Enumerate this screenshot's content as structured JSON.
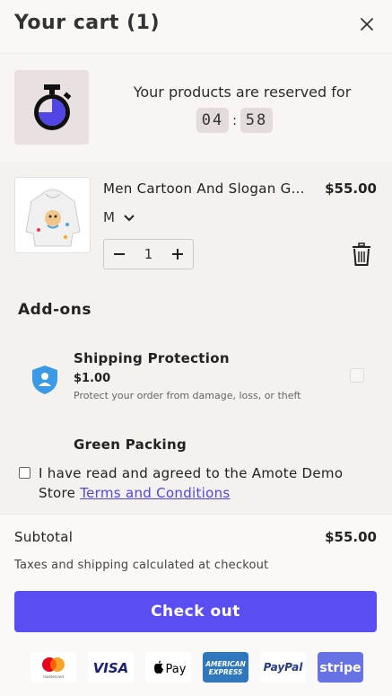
{
  "header": {
    "title": "Your cart (1)"
  },
  "timer": {
    "message": "Your products are reserved for",
    "minutes": "04",
    "separator": ":",
    "seconds": "58"
  },
  "cart_item": {
    "name": "Men Cartoon And Slogan Graphic Hoodie",
    "price": "$55.00",
    "variant": "M",
    "quantity": "1"
  },
  "addons": {
    "title": "Add-ons",
    "items": [
      {
        "title": "Shipping Protection",
        "price": "$1.00",
        "description": "Protect your order from damage, loss, or theft"
      },
      {
        "title": "Green Packing"
      }
    ]
  },
  "terms": {
    "text": "I have read and agreed to the Amote Demo Store ",
    "link": "Terms and Conditions"
  },
  "footer": {
    "subtotal_label": "Subtotal",
    "subtotal_value": "$55.00",
    "tax_note": "Taxes and shipping calculated at checkout",
    "checkout_label": "Check out"
  },
  "payment_methods": {
    "mastercard": {
      "label": "mastercard"
    },
    "visa": {
      "label": "VISA"
    },
    "applepay": {
      "label": "Pay"
    },
    "amex": {
      "line1": "AMERICAN",
      "line2": "EXPRESS"
    },
    "paypal": {
      "label": "PayPal"
    },
    "stripe": {
      "label": "stripe"
    }
  },
  "colors": {
    "accent": "#5a4ef3",
    "link": "#4f46e5",
    "shield": "#3b9ae6"
  }
}
